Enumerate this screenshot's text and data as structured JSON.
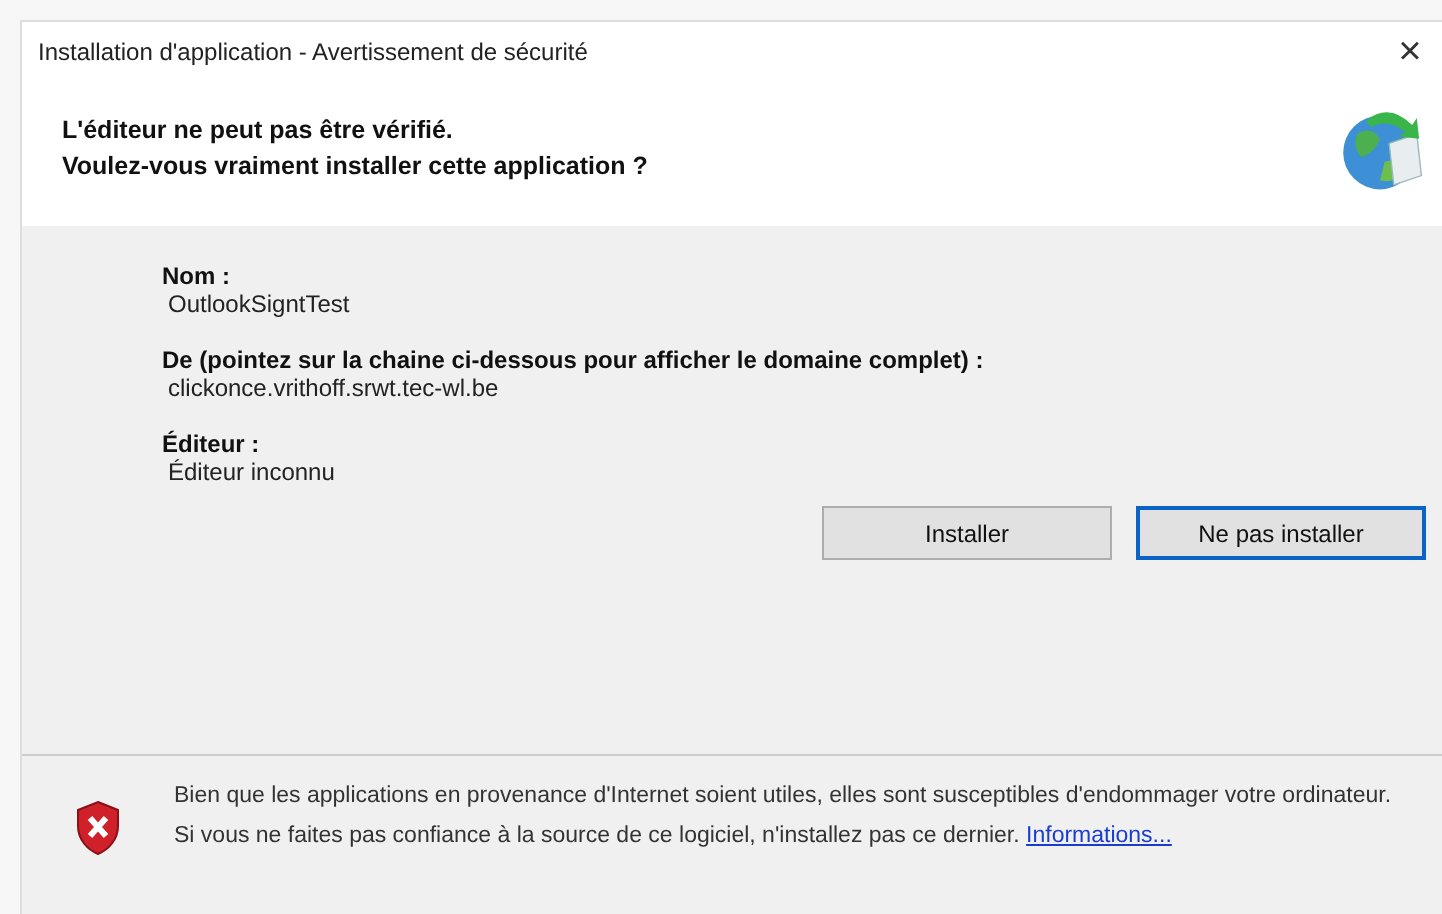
{
  "window": {
    "title": "Installation d'application - Avertissement de sécurité",
    "close": "×"
  },
  "header": {
    "lines": [
      "L'éditeur ne peut pas être vérifié.",
      "Voulez-vous vraiment installer cette application ?"
    ]
  },
  "fields": [
    {
      "label": "Nom :",
      "value": "OutlookSigntTest"
    },
    {
      "label": "De (pointez sur la chaine ci-dessous pour afficher le domaine complet) :",
      "value": "clickonce.vrithoff.srwt.tec-wl.be"
    },
    {
      "label": "Éditeur :",
      "value": "Éditeur inconnu"
    }
  ],
  "buttons": [
    {
      "label": "Installer",
      "focused": false
    },
    {
      "label": "Ne pas installer",
      "focused": true
    }
  ],
  "warning": {
    "text": "Bien que les applications en provenance d'Internet soient utiles, elles sont susceptibles d'endommager votre ordinateur. Si vous ne faites pas confiance à la source de ce logiciel, n'installez pas ce dernier.",
    "link": "Informations..."
  }
}
